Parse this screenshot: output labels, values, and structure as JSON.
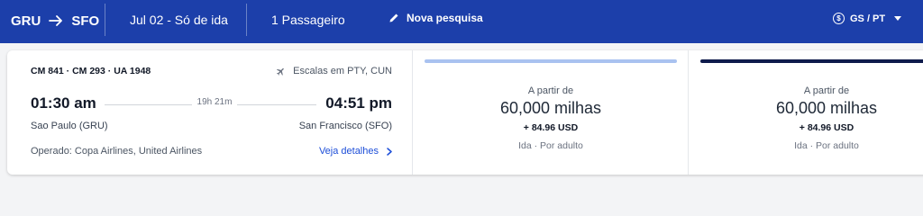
{
  "header": {
    "origin": "GRU",
    "destination": "SFO",
    "date_label": "Jul 02 - Só de ida",
    "passengers_label": "1 Passageiro",
    "new_search_label": "Nova pesquisa",
    "currency_language_label": "GS / PT",
    "background_color": "#1c3faa"
  },
  "flight": {
    "flight_numbers": "CM 841 · CM 293 · UA 1948",
    "stops_label": "Escalas em PTY, CUN",
    "departure_time": "01:30 am",
    "arrival_time": "04:51 pm",
    "duration": "19h 21m",
    "departure_city": "Sao Paulo (GRU)",
    "arrival_city": "San Francisco (SFO)",
    "operated_by": "Operado: Copa Airlines, United Airlines",
    "details_link": "Veja detalhes"
  },
  "fares": [
    {
      "from_label": "A partir de",
      "miles": "60,000 milhas",
      "taxes": "+ 84.96 USD",
      "trip_type": "Ida · Por adulto",
      "accent_color": "#a9c2f0"
    },
    {
      "from_label": "A partir de",
      "miles": "60,000 milhas",
      "taxes": "+ 84.96 USD",
      "trip_type": "Ida · Por adulto",
      "accent_color": "#0f1b4c"
    }
  ],
  "icons": {
    "route_arrow": "arrow-right-icon",
    "new_search": "pencil-icon",
    "currency": "dollar-circle-icon",
    "dropdown": "caret-down-icon",
    "stops": "plane-icon",
    "details": "chevron-right-icon"
  }
}
